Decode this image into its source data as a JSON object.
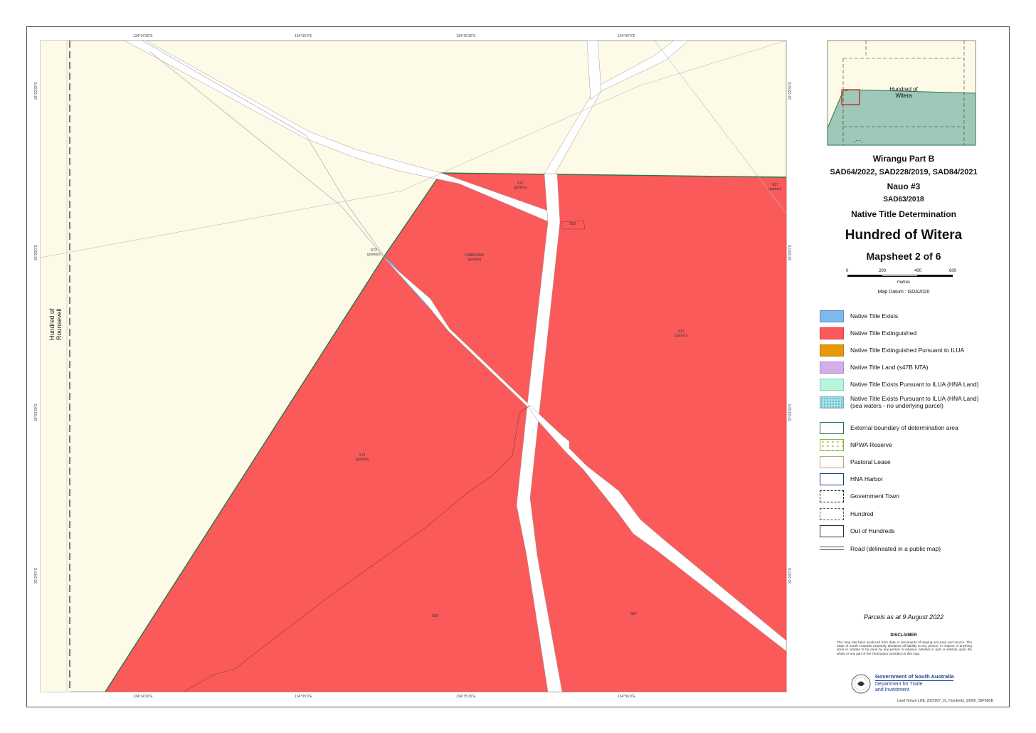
{
  "map": {
    "coords_top": [
      "134°34'30\"E",
      "134°35'0\"E",
      "134°35'30\"E",
      "134°36'0\"E"
    ],
    "coords_bottom": [
      "134°34'30\"E",
      "134°35'0\"E",
      "134°35'30\"E",
      "134°36'0\"E"
    ],
    "coords_left": [
      "32°22'30\"S",
      "32°23'0\"S",
      "32°23'30\"S",
      "32°24'0\"S"
    ],
    "coords_right": [
      "32°22'30\"S",
      "32°23'0\"S",
      "32°23'30\"S",
      "32°24'0\"S"
    ],
    "hundred_line1": "Hundred of",
    "hundred_line2": "Rounsevell",
    "parcels": {
      "p1": "S17\n(portion)",
      "p2": "S67\n(portion)",
      "p3": "S53",
      "p4": "S72\n(portion)",
      "p5": "D38863443\n(portion)",
      "p6": "S31\n(portion)",
      "p7": "S71\n(portion)",
      "p8": "S95",
      "p9": "S67"
    }
  },
  "inset": {
    "label_line1": "Hundred of",
    "label_line2": "Witera"
  },
  "titles": {
    "t1": "Wirangu Part B",
    "t2": "SAD64/2022, SAD228/2019, SAD84/2021",
    "t3": "Nauo #3",
    "t4": "SAD63/2018",
    "t5": "Native Title Determination",
    "t6": "Hundred of Witera",
    "t7": "Mapsheet 2 of 6"
  },
  "scale": {
    "labels": [
      "0",
      "200",
      "400",
      "600"
    ],
    "units": "metres",
    "datum": "Map Datum : GDA2020"
  },
  "legend": [
    {
      "label": "Native Title Exists",
      "fill": "#7fb8ef",
      "border": "#5a8fc8",
      "style": "solid"
    },
    {
      "label": "Native Title Extinguished",
      "fill": "#fb5a5a",
      "border": "#d84040",
      "style": "solid"
    },
    {
      "label": "Native Title Extinguished Pursuant to ILUA",
      "fill": "#e69a0a",
      "border": "#c07e00",
      "style": "solid"
    },
    {
      "label": "Native Title Land (s47B NTA)",
      "fill": "#d4aee8",
      "border": "#b08ac8",
      "style": "solid"
    },
    {
      "label": "Native Title Exists Pursuant to ILUA (HNA Land)",
      "fill": "#b8f5e0",
      "border": "#80d0b8",
      "style": "solid"
    },
    {
      "label": "Native Title Exists Pursuant to ILUA (HNA Land)\n(sea waters - no underlying parcel)",
      "fill": "#a8e0e8",
      "border": "#70b0c0",
      "style": "dots"
    },
    {
      "label": "External boundary of determination area",
      "fill": "#ffffff",
      "border": "#1f7a4a",
      "style": "solid"
    },
    {
      "label": "NPWA Reserve",
      "fill": "#ffffff",
      "border": "#8ab83a",
      "style": "npwa"
    },
    {
      "label": "Pastoral Lease",
      "fill": "#ffffff",
      "border": "#b8a870",
      "style": "solid"
    },
    {
      "label": "HNA Harbor",
      "fill": "#ffffff",
      "border": "#1a3d8f",
      "style": "solid"
    },
    {
      "label": "Government Town",
      "fill": "#ffffff",
      "border": "#111111",
      "style": "dashdot"
    },
    {
      "label": "Hundred",
      "fill": "#ffffff",
      "border": "#555555",
      "style": "dashed"
    },
    {
      "label": "Out of Hundreds",
      "fill": "#ffffff",
      "border": "#333333",
      "style": "solid"
    },
    {
      "label": "Road (delineated in a public map)",
      "fill": "none",
      "border": "#555555",
      "style": "road"
    }
  ],
  "parcels_date": "Parcels as at 9 August 2022",
  "disclaimer": {
    "title": "DISCLAIMER",
    "text": "This map has been produced from data or documents of varying accuracy and source. The State of South Australia expressly disclaims all liability to any person, in respect of anything done or omitted to be done by any person in reliance, whether in part or entirely, upon the whole or any part of the information provided on this map."
  },
  "govt": {
    "name": "Government of South Australia",
    "dept_line1": "Department for Trade",
    "dept_line2": "and Investment"
  },
  "footer_ref": "Land Tenure LDE_2022007_01_Hundreds_10000_ISIP6B2B"
}
